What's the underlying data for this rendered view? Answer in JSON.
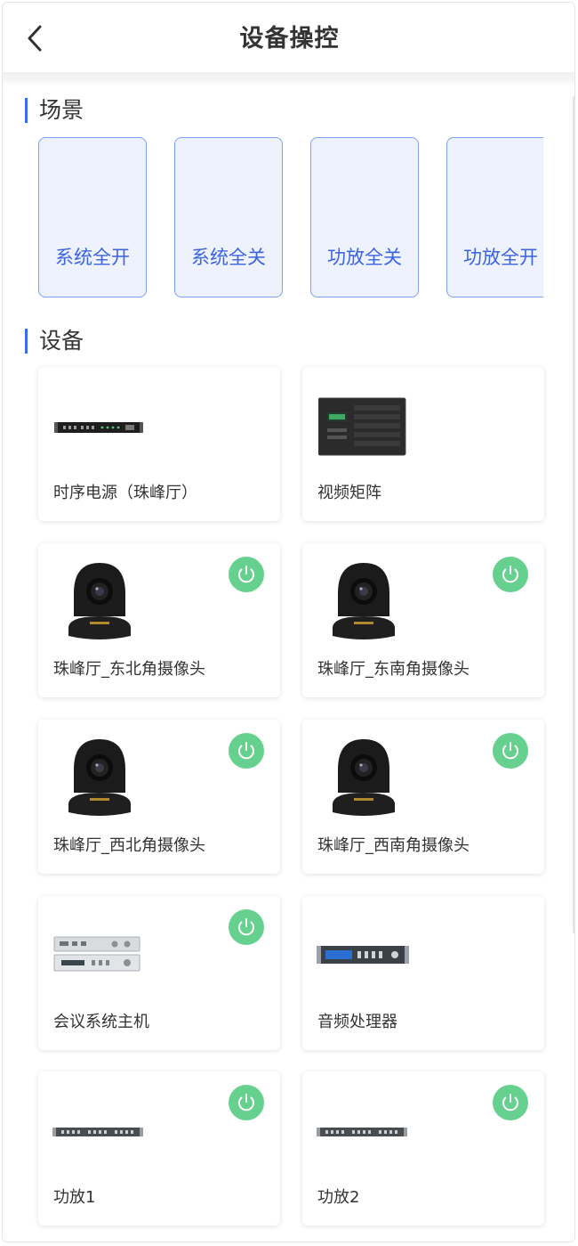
{
  "header": {
    "title": "设备操控",
    "back_icon": "chevron-left-icon"
  },
  "scenes": {
    "title": "场景",
    "items": [
      {
        "label": "系统全开"
      },
      {
        "label": "系统全关"
      },
      {
        "label": "功放全关"
      },
      {
        "label": "功放全开"
      }
    ]
  },
  "devices": {
    "title": "设备",
    "items": [
      {
        "name": "时序电源（珠峰厅）",
        "image": "rack-power-sequencer",
        "power_button": false
      },
      {
        "name": "视频矩阵",
        "image": "video-matrix-chassis",
        "power_button": false
      },
      {
        "name": "珠峰厅_东北角摄像头",
        "image": "ptz-camera",
        "power_button": true
      },
      {
        "name": "珠峰厅_东南角摄像头",
        "image": "ptz-camera",
        "power_button": true
      },
      {
        "name": "珠峰厅_西北角摄像头",
        "image": "ptz-camera",
        "power_button": true
      },
      {
        "name": "珠峰厅_西南角摄像头",
        "image": "ptz-camera",
        "power_button": true
      },
      {
        "name": "会议系统主机",
        "image": "conference-host-units",
        "power_button": true
      },
      {
        "name": "音频处理器",
        "image": "audio-processor-rack",
        "power_button": false
      },
      {
        "name": "功放1",
        "image": "rack-amplifier",
        "power_button": true
      },
      {
        "name": "功放2",
        "image": "rack-amplifier",
        "power_button": true
      }
    ]
  },
  "colors": {
    "accent": "#3b6cf0",
    "scene_bg": "#eef2fd",
    "scene_text": "#3b63e0",
    "power_green": "#66d18f"
  }
}
